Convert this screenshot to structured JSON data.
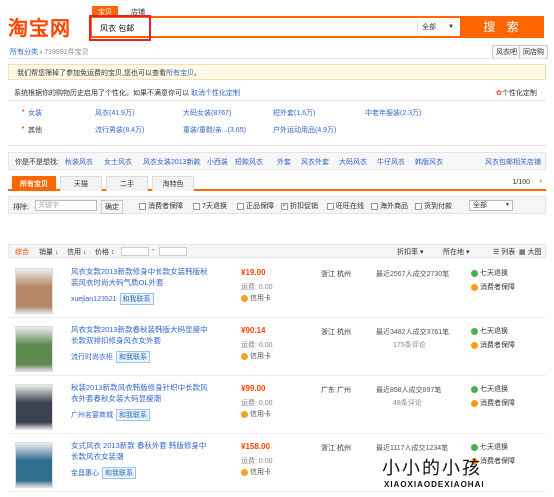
{
  "logo": "淘宝网",
  "search": {
    "tab_baobei": "宝贝",
    "tab_shop": "店铺",
    "query": "风衣 包邮",
    "category": "全部",
    "button": "搜 索"
  },
  "crumb": {
    "all": "所有分类",
    "sep": "›",
    "count": "719991件宝贝",
    "right1": "风衣吧",
    "right2": "同店购"
  },
  "notice": {
    "text1": "我们帮您筛掉了参加免运费的宝贝,您也可以查看",
    "link": "所有宝贝",
    "text2": "。"
  },
  "personal": {
    "text": "系统根据你的购物历史启用了个性化。如果不满意你可以",
    "link": "取消个性化定制",
    "right": "个性化定制"
  },
  "props": {
    "row1": {
      "label": "女装",
      "c1": "风衣(41.9万)",
      "c2": "大码女装(8767)",
      "c3": "短外套(1.6万)",
      "c4": "中老年服装(2.3万)"
    },
    "row2": {
      "label": "其他",
      "c1": "流行男装(8.4万)",
      "c2": "童装/童鞋/亲...(3.65)",
      "c3": "户外运动用品(4.9万)"
    }
  },
  "related": {
    "label": "你是不是想找:",
    "items": [
      "秋装风衣",
      "女士风衣",
      "风衣女装2013新款",
      "小西装",
      "短款风衣",
      "外套",
      "风衣外套",
      "大码风衣",
      "牛仔风衣",
      "韩版风衣"
    ],
    "right": "风衣包邮相关店铺"
  },
  "tabs": [
    "所有宝贝",
    "天猫",
    "二手",
    "淘特色"
  ],
  "page_ind": "1/100",
  "filter": {
    "search_placeholder": "关键字",
    "search_label": "排除:",
    "confirm": "确定",
    "checks": [
      "消费者保障",
      "7天退换",
      "正品保障",
      "折扣促销",
      "旺旺在线",
      "海外商品",
      "货到付款"
    ],
    "select": "全部"
  },
  "sort": {
    "items": [
      "综合",
      "销量",
      "信用",
      "价格"
    ],
    "price_sep": "-",
    "right1": "折扣率",
    "right2": "所在地",
    "view1": "列表",
    "view2": "大图"
  },
  "items": [
    {
      "title": "风衣女款2013新款修身中长款女装韩版秋装风衣时尚大码气质OL外套",
      "seller": "xuejian123521",
      "price": "19.00",
      "ship": "运费: 0.00",
      "card": "信用卡",
      "loc": "浙江 杭州",
      "sales": "最近2567人成交2730笔",
      "reviews": "",
      "svc1": "七天退换",
      "svc2": "消费者保障",
      "thumb_color": "#b48766"
    },
    {
      "title": "风衣女款2013新款春秋装韩版大码显瘦中长款双排扣修身风衣女外套",
      "seller": "流行时尚衣柜",
      "price": "90.14",
      "ship": "运费: 0.00",
      "card": "信用卡",
      "loc": "浙江 杭州",
      "sales": "最近3482人成交3761笔",
      "reviews": "175条评论",
      "svc1": "七天退换",
      "svc2": "消费者保障",
      "thumb_color": "#5e8a52"
    },
    {
      "title": "秋装2013新款风衣韩版修身针织中长款风衣外套春秋女装大码显瘦潮",
      "seller": "广州名宴商城",
      "price": "99.00",
      "ship": "运费: 0.00",
      "card": "信用卡",
      "loc": "广东 广州",
      "sales": "最近858人成交897笔",
      "reviews": "48条评论",
      "svc1": "七天退换",
      "svc2": "消费者保障",
      "thumb_color": "#3b4150"
    },
    {
      "title": "女式风衣 2013新款 春秋外套 韩版修身中长款风衣女装潮",
      "seller": "金昌惠心",
      "price": "158.00",
      "ship": "运费: 0.00",
      "card": "信用卡",
      "loc": "浙江 杭州",
      "sales": "最近1117人成交1234笔",
      "reviews": "",
      "svc1": "七天退换",
      "svc2": "消费者保障",
      "thumb_color": "#2f6e8f"
    }
  ],
  "watermark": {
    "big": "小小的小孩",
    "small": "XIAOXIAODEXIAOHAI"
  }
}
